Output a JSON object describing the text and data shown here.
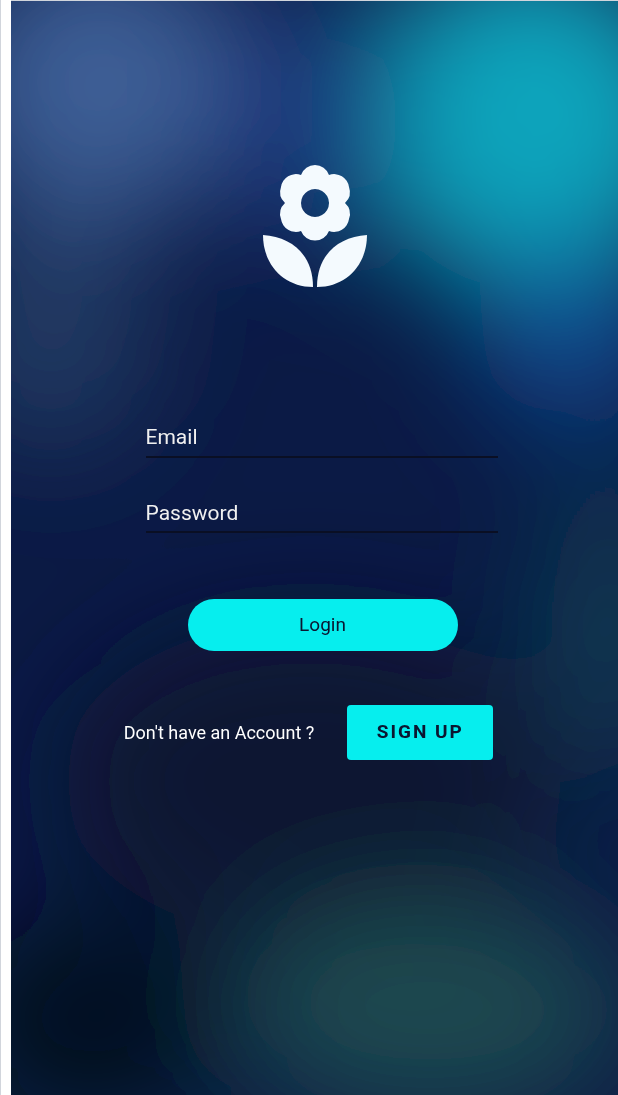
{
  "logo": {
    "kind": "flower"
  },
  "form": {
    "email": {
      "placeholder": "Email"
    },
    "password": {
      "placeholder": "Password"
    },
    "login_button": "Login"
  },
  "signup": {
    "prompt": "Don't have an Account ?",
    "button": "SIGN UP"
  }
}
